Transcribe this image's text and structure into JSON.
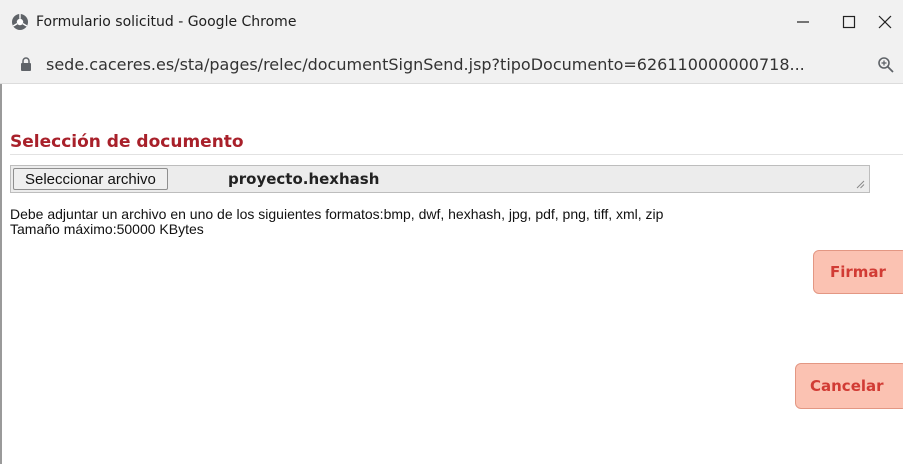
{
  "window": {
    "title": "Formulario solicitud - Google Chrome",
    "controls": {
      "minimize_icon": "minimize-icon",
      "maximize_icon": "maximize-icon",
      "close_icon": "close-icon"
    }
  },
  "addressbar": {
    "url": "sede.caceres.es/sta/pages/relec/documentSignSend.jsp?tipoDocumento=626110000000718...",
    "lock_icon": "lock-icon",
    "zoom_icon": "zoom-icon"
  },
  "form": {
    "section_title": "Selección de documento",
    "file_button_label": "Seleccionar archivo",
    "file_name": "proyecto.hexhash",
    "help_formats": "Debe adjuntar un archivo en uno de los siguientes formatos:bmp, dwf, hexhash, jpg, pdf, png, tiff, xml, zip",
    "help_size": "Tamaño máximo:50000 KBytes"
  },
  "actions": {
    "firmar_label": "Firmar",
    "cancelar_label": "Cancelar"
  },
  "colors": {
    "section_title": "#a8202a",
    "button_bg": "#fbc2b2",
    "button_text": "#d13b34"
  }
}
